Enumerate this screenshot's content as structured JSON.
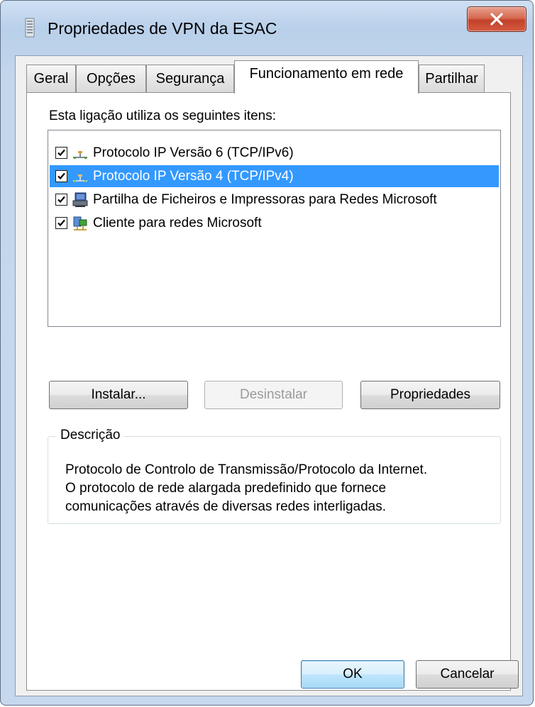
{
  "window": {
    "title": "Propriedades de VPN da ESAC",
    "close_label": "X"
  },
  "tabs": [
    {
      "label": "Geral",
      "active": false
    },
    {
      "label": "Opções",
      "active": false
    },
    {
      "label": "Segurança",
      "active": false
    },
    {
      "label": "Funcionamento em rede",
      "active": true
    },
    {
      "label": "Partilhar",
      "active": false
    }
  ],
  "network": {
    "items_label": "Esta ligação utiliza os seguintes itens:",
    "items": [
      {
        "label": "Protocolo IP Versão 6 (TCP/IPv6)",
        "checked": true,
        "selected": false,
        "icon": "network-protocol-icon"
      },
      {
        "label": "Protocolo IP Versão 4 (TCP/IPv4)",
        "checked": true,
        "selected": true,
        "icon": "network-protocol-icon"
      },
      {
        "label": "Partilha de Ficheiros e Impressoras para Redes Microsoft",
        "checked": true,
        "selected": false,
        "icon": "file-printer-sharing-icon"
      },
      {
        "label": "Cliente para redes Microsoft",
        "checked": true,
        "selected": false,
        "icon": "network-client-icon"
      }
    ],
    "buttons": {
      "install": "Instalar...",
      "uninstall": "Desinstalar",
      "properties": "Propriedades"
    }
  },
  "description": {
    "title": "Descrição",
    "text": "Protocolo de Controlo de Transmissão/Protocolo da Internet.\nO protocolo de rede alargada predefinido que fornece\ncomunicações através de diversas redes interligadas."
  },
  "dialog_buttons": {
    "ok": "OK",
    "cancel": "Cancelar"
  },
  "colors": {
    "selection": "#3399ff",
    "close_button": "#c2412a"
  }
}
